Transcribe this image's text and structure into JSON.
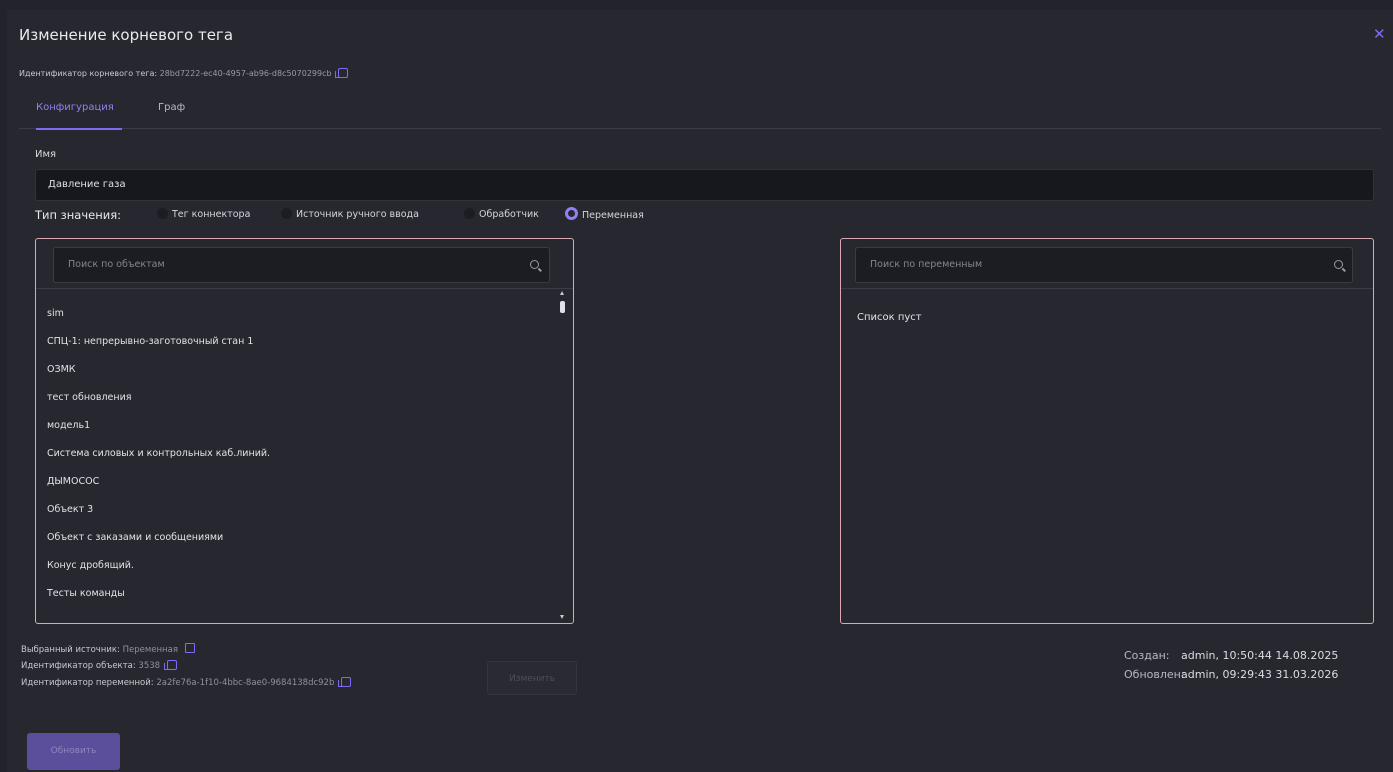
{
  "dialog": {
    "title": "Изменение корневого тега",
    "close_icon": "close-icon",
    "root_id_label": "Идентификатор корневого тега:",
    "root_id_value": "28bd7222-ec40-4957-ab96-d8c5070299cb"
  },
  "tabs": [
    {
      "label": "Конфигурация",
      "active": true
    },
    {
      "label": "Граф",
      "active": false
    }
  ],
  "form": {
    "name_label": "Имя",
    "name_value": "Давление газа",
    "value_type_label": "Тип значения:",
    "value_types": [
      {
        "label": "Тег коннектора",
        "selected": false
      },
      {
        "label": "Источник ручного ввода",
        "selected": false
      },
      {
        "label": "Обработчик",
        "selected": false
      },
      {
        "label": "Переменная",
        "selected": true
      }
    ]
  },
  "objects_panel": {
    "search_placeholder": "Поиск по объектам",
    "items": [
      "sim",
      "СПЦ-1: непрерывно-заготовочный стан 1",
      "ОЗМК",
      "тест обновления",
      "модель1",
      "Система силовых и контрольных каб.линий.",
      "ДЫМОСОС",
      "Объект 3",
      "Объект с заказами и сообщениями",
      "Конус дробящий.",
      "Тесты команды"
    ]
  },
  "variables_panel": {
    "search_placeholder": "Поиск по переменным",
    "empty_text": "Список пуст"
  },
  "selection": {
    "source_label": "Выбранный источник:",
    "source_value": "Переменная",
    "object_id_label": "Идентификатор объекта:",
    "object_id_value": "3538",
    "variable_id_label": "Идентификатор переменной:",
    "variable_id_value": "2a2fe76a-1f10-4bbc-8ae0-9684138dc92b",
    "change_button": "Изменить"
  },
  "audit": {
    "created_label": "Создан:",
    "created_value": "admin, 10:50:44 14.08.2025",
    "updated_label": "Обновлен:",
    "updated_value": "admin, 09:29:43 31.03.2026"
  },
  "footer": {
    "update_button": "Обновить"
  },
  "colors": {
    "accent": "#7c6cf2",
    "panel_border": "#d9a8b0",
    "background": "#27282f"
  }
}
